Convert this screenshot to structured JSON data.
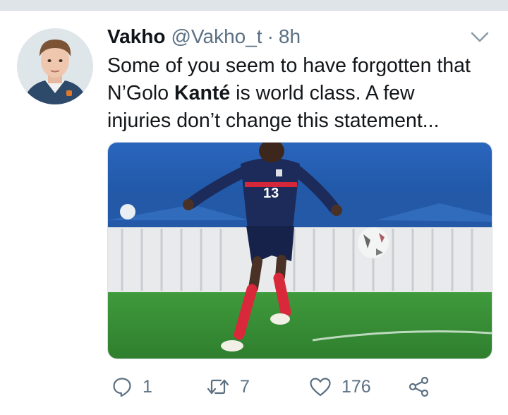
{
  "tweet": {
    "author": {
      "name": "Vakho",
      "handle": "@Vakho_t",
      "separator": "·",
      "time": "8h"
    },
    "text": {
      "line1": "Some of you seem to have forgotten that",
      "line2_before": "N’Golo ",
      "line2_bold": "Kanté",
      "line2_after": " is world class. A few",
      "line3": "injuries don’t change this statement..."
    },
    "media": {
      "jersey_number": "13"
    },
    "actions": {
      "reply_count": "1",
      "retweet_count": "7",
      "like_count": "176"
    }
  },
  "colors": {
    "secondary_text": "#5b7083",
    "primary_text": "#14171a",
    "pitch_green": "#3b8f3a",
    "jersey_navy": "#1c2b5a",
    "stadium_blue": "#1f5fb0"
  },
  "icons": [
    "chevron-down-icon",
    "reply-icon",
    "retweet-icon",
    "like-icon",
    "share-icon"
  ]
}
